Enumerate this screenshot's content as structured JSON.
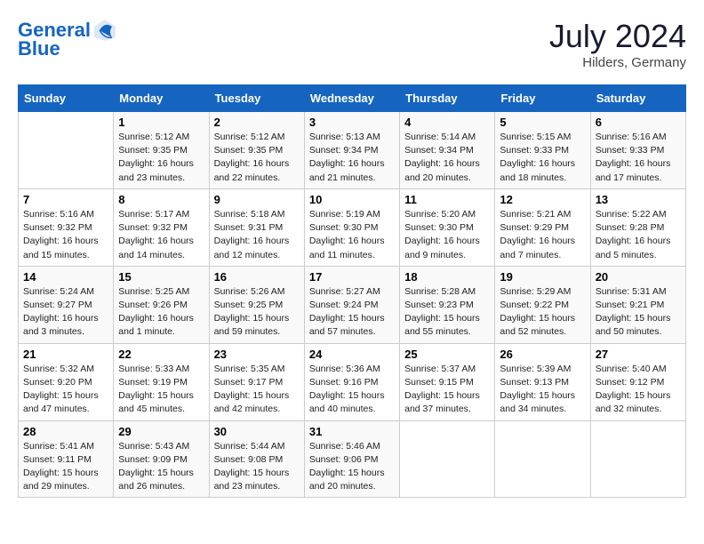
{
  "header": {
    "logo_line1": "General",
    "logo_line2": "Blue",
    "month": "July 2024",
    "location": "Hilders, Germany"
  },
  "weekdays": [
    "Sunday",
    "Monday",
    "Tuesday",
    "Wednesday",
    "Thursday",
    "Friday",
    "Saturday"
  ],
  "weeks": [
    [
      {
        "num": "",
        "info": ""
      },
      {
        "num": "1",
        "info": "Sunrise: 5:12 AM\nSunset: 9:35 PM\nDaylight: 16 hours\nand 23 minutes."
      },
      {
        "num": "2",
        "info": "Sunrise: 5:12 AM\nSunset: 9:35 PM\nDaylight: 16 hours\nand 22 minutes."
      },
      {
        "num": "3",
        "info": "Sunrise: 5:13 AM\nSunset: 9:34 PM\nDaylight: 16 hours\nand 21 minutes."
      },
      {
        "num": "4",
        "info": "Sunrise: 5:14 AM\nSunset: 9:34 PM\nDaylight: 16 hours\nand 20 minutes."
      },
      {
        "num": "5",
        "info": "Sunrise: 5:15 AM\nSunset: 9:33 PM\nDaylight: 16 hours\nand 18 minutes."
      },
      {
        "num": "6",
        "info": "Sunrise: 5:16 AM\nSunset: 9:33 PM\nDaylight: 16 hours\nand 17 minutes."
      }
    ],
    [
      {
        "num": "7",
        "info": "Sunrise: 5:16 AM\nSunset: 9:32 PM\nDaylight: 16 hours\nand 15 minutes."
      },
      {
        "num": "8",
        "info": "Sunrise: 5:17 AM\nSunset: 9:32 PM\nDaylight: 16 hours\nand 14 minutes."
      },
      {
        "num": "9",
        "info": "Sunrise: 5:18 AM\nSunset: 9:31 PM\nDaylight: 16 hours\nand 12 minutes."
      },
      {
        "num": "10",
        "info": "Sunrise: 5:19 AM\nSunset: 9:30 PM\nDaylight: 16 hours\nand 11 minutes."
      },
      {
        "num": "11",
        "info": "Sunrise: 5:20 AM\nSunset: 9:30 PM\nDaylight: 16 hours\nand 9 minutes."
      },
      {
        "num": "12",
        "info": "Sunrise: 5:21 AM\nSunset: 9:29 PM\nDaylight: 16 hours\nand 7 minutes."
      },
      {
        "num": "13",
        "info": "Sunrise: 5:22 AM\nSunset: 9:28 PM\nDaylight: 16 hours\nand 5 minutes."
      }
    ],
    [
      {
        "num": "14",
        "info": "Sunrise: 5:24 AM\nSunset: 9:27 PM\nDaylight: 16 hours\nand 3 minutes."
      },
      {
        "num": "15",
        "info": "Sunrise: 5:25 AM\nSunset: 9:26 PM\nDaylight: 16 hours\nand 1 minute."
      },
      {
        "num": "16",
        "info": "Sunrise: 5:26 AM\nSunset: 9:25 PM\nDaylight: 15 hours\nand 59 minutes."
      },
      {
        "num": "17",
        "info": "Sunrise: 5:27 AM\nSunset: 9:24 PM\nDaylight: 15 hours\nand 57 minutes."
      },
      {
        "num": "18",
        "info": "Sunrise: 5:28 AM\nSunset: 9:23 PM\nDaylight: 15 hours\nand 55 minutes."
      },
      {
        "num": "19",
        "info": "Sunrise: 5:29 AM\nSunset: 9:22 PM\nDaylight: 15 hours\nand 52 minutes."
      },
      {
        "num": "20",
        "info": "Sunrise: 5:31 AM\nSunset: 9:21 PM\nDaylight: 15 hours\nand 50 minutes."
      }
    ],
    [
      {
        "num": "21",
        "info": "Sunrise: 5:32 AM\nSunset: 9:20 PM\nDaylight: 15 hours\nand 47 minutes."
      },
      {
        "num": "22",
        "info": "Sunrise: 5:33 AM\nSunset: 9:19 PM\nDaylight: 15 hours\nand 45 minutes."
      },
      {
        "num": "23",
        "info": "Sunrise: 5:35 AM\nSunset: 9:17 PM\nDaylight: 15 hours\nand 42 minutes."
      },
      {
        "num": "24",
        "info": "Sunrise: 5:36 AM\nSunset: 9:16 PM\nDaylight: 15 hours\nand 40 minutes."
      },
      {
        "num": "25",
        "info": "Sunrise: 5:37 AM\nSunset: 9:15 PM\nDaylight: 15 hours\nand 37 minutes."
      },
      {
        "num": "26",
        "info": "Sunrise: 5:39 AM\nSunset: 9:13 PM\nDaylight: 15 hours\nand 34 minutes."
      },
      {
        "num": "27",
        "info": "Sunrise: 5:40 AM\nSunset: 9:12 PM\nDaylight: 15 hours\nand 32 minutes."
      }
    ],
    [
      {
        "num": "28",
        "info": "Sunrise: 5:41 AM\nSunset: 9:11 PM\nDaylight: 15 hours\nand 29 minutes."
      },
      {
        "num": "29",
        "info": "Sunrise: 5:43 AM\nSunset: 9:09 PM\nDaylight: 15 hours\nand 26 minutes."
      },
      {
        "num": "30",
        "info": "Sunrise: 5:44 AM\nSunset: 9:08 PM\nDaylight: 15 hours\nand 23 minutes."
      },
      {
        "num": "31",
        "info": "Sunrise: 5:46 AM\nSunset: 9:06 PM\nDaylight: 15 hours\nand 20 minutes."
      },
      {
        "num": "",
        "info": ""
      },
      {
        "num": "",
        "info": ""
      },
      {
        "num": "",
        "info": ""
      }
    ]
  ]
}
